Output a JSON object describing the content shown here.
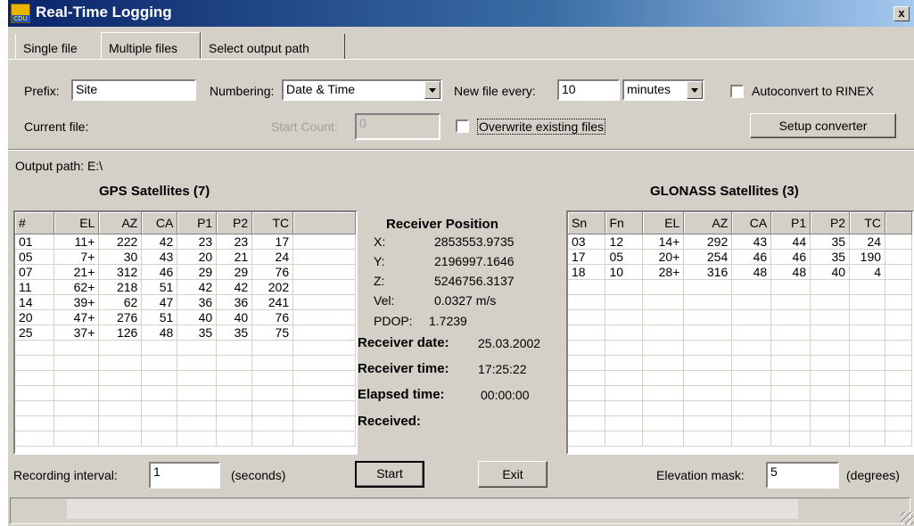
{
  "window": {
    "title": "Real-Time Logging",
    "close_label": "x",
    "icon_label": "CDU"
  },
  "tabs": [
    {
      "label": "Single file"
    },
    {
      "label": "Multiple files"
    },
    {
      "label": "Select output path"
    }
  ],
  "form": {
    "prefix_label": "Prefix:",
    "prefix_value": "Site",
    "numbering_label": "Numbering:",
    "numbering_value": "Date & Time",
    "new_file_label": "New file every:",
    "new_file_value": "10",
    "unit_value": "minutes",
    "autoconvert_label": "Autoconvert to RINEX",
    "current_file_label": "Current file:",
    "start_count_label": "Start Count:",
    "start_count_value": "0",
    "overwrite_label": "Overwrite existing files",
    "setup_converter_label": "Setup converter"
  },
  "output_path": "Output path: E:\\",
  "gps": {
    "title": "GPS Satellites (7)",
    "columns": [
      "#",
      "EL",
      "AZ",
      "CA",
      "P1",
      "P2",
      "TC"
    ],
    "rows": [
      [
        "01",
        "11+",
        "222",
        "42",
        "23",
        "23",
        "17"
      ],
      [
        "05",
        "7+",
        "30",
        "43",
        "20",
        "21",
        "24"
      ],
      [
        "07",
        "21+",
        "312",
        "46",
        "29",
        "29",
        "76"
      ],
      [
        "11",
        "62+",
        "218",
        "51",
        "42",
        "42",
        "202"
      ],
      [
        "14",
        "39+",
        "62",
        "47",
        "36",
        "36",
        "241"
      ],
      [
        "20",
        "47+",
        "276",
        "51",
        "40",
        "40",
        "76"
      ],
      [
        "25",
        "37+",
        "126",
        "48",
        "35",
        "35",
        "75"
      ]
    ]
  },
  "glonass": {
    "title": "GLONASS Satellites (3)",
    "columns": [
      "Sn",
      "Fn",
      "EL",
      "AZ",
      "CA",
      "P1",
      "P2",
      "TC"
    ],
    "rows": [
      [
        "03",
        "12",
        "14+",
        "292",
        "43",
        "44",
        "35",
        "24"
      ],
      [
        "17",
        "05",
        "20+",
        "254",
        "46",
        "46",
        "35",
        "190"
      ],
      [
        "18",
        "10",
        "28+",
        "316",
        "48",
        "48",
        "40",
        "4"
      ]
    ]
  },
  "receiver": {
    "title": "Receiver Position",
    "x_label": "X:",
    "x_value": "2853553.9735",
    "y_label": "Y:",
    "y_value": "2196997.1646",
    "z_label": "Z:",
    "z_value": "5246756.3137",
    "vel_label": "Vel:",
    "vel_value": "0.0327 m/s",
    "pdop_label": "PDOP:",
    "pdop_value": "1.7239",
    "date_label": "Receiver date:",
    "date_value": "25.03.2002",
    "time_label": "Receiver time:",
    "time_value": "17:25:22",
    "elapsed_label": "Elapsed time:",
    "elapsed_value": "00:00:00",
    "received_label": "Received:"
  },
  "bottom": {
    "interval_label": "Recording interval:",
    "interval_value": "1",
    "interval_unit": "(seconds)",
    "start_label": "Start",
    "exit_label": "Exit",
    "elevation_label": "Elevation mask:",
    "elevation_value": "5",
    "elevation_unit": "(degrees)"
  }
}
